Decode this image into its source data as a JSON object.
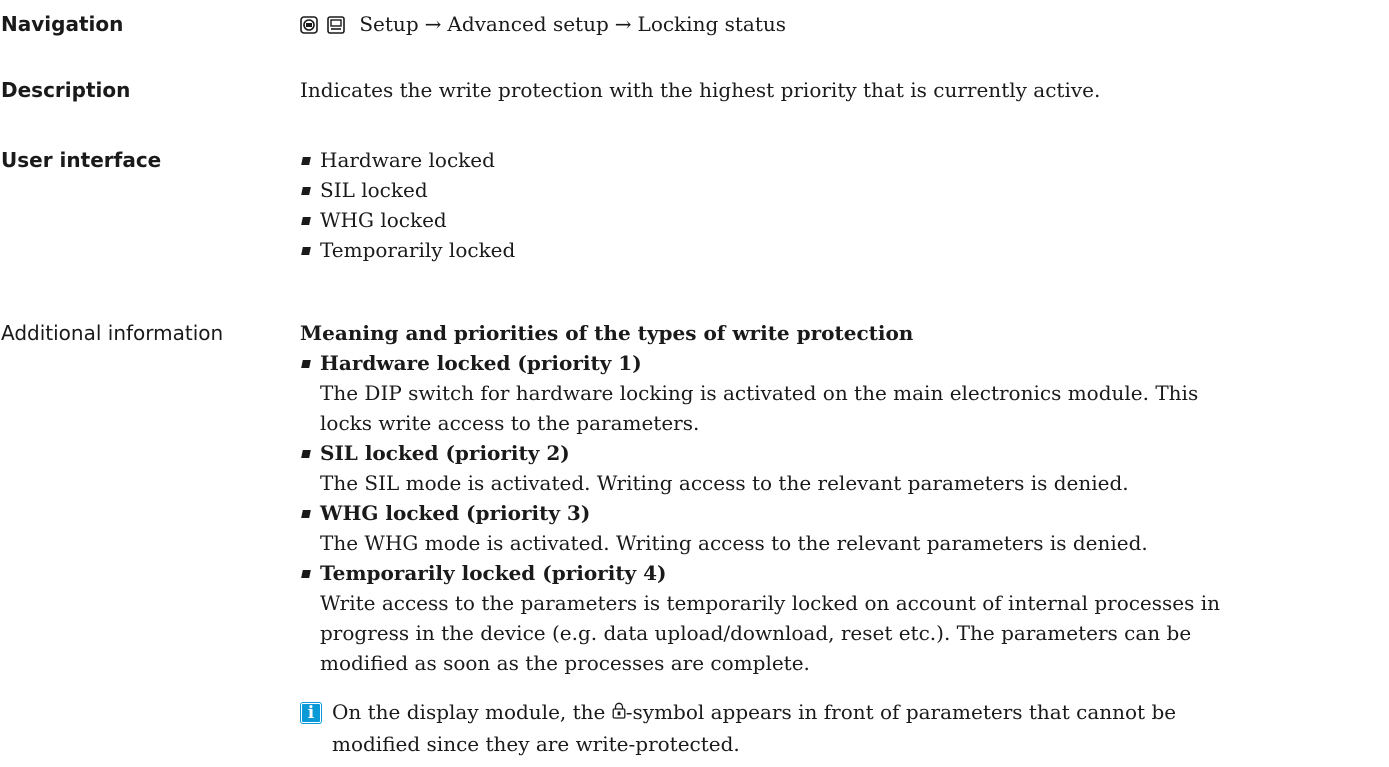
{
  "navigation": {
    "label": "Navigation",
    "path": [
      "Setup",
      "Advanced setup",
      "Locking status"
    ],
    "separator": "→",
    "icons": [
      "display-operating-icon",
      "display-module-icon"
    ]
  },
  "description": {
    "label": "Description",
    "text": "Indicates the write protection with the highest priority that is currently active."
  },
  "user_interface": {
    "label": "User interface",
    "options": [
      "Hardware locked",
      "SIL locked",
      "WHG locked",
      "Temporarily locked"
    ]
  },
  "additional_information": {
    "label": "Additional information",
    "heading": "Meaning and priorities of the types of write protection",
    "items": [
      {
        "title": "Hardware locked (priority 1)",
        "lines": [
          "The DIP switch for hardware locking is activated on the main electronics module. This",
          "locks write access to the parameters."
        ]
      },
      {
        "title": "SIL locked (priority 2)",
        "lines": [
          "The SIL mode is activated. Writing access to the relevant parameters is denied."
        ]
      },
      {
        "title": "WHG locked (priority 3)",
        "lines": [
          "The WHG mode is activated. Writing access to the relevant parameters is denied."
        ]
      },
      {
        "title": "Temporarily locked (priority 4)",
        "lines": [
          "Write access to the parameters is temporarily locked on account of internal processes in",
          "progress in the device (e.g. data upload/download, reset etc.). The parameters can be",
          "modified as soon as the processes are complete."
        ]
      }
    ],
    "note": {
      "icon": "info-icon",
      "icon_glyph": "i",
      "text_before": "On the display module, the ",
      "text_after": "-symbol appears in front of parameters that cannot be",
      "text_line2": "modified since they are write-protected.",
      "symbol_icon": "lock-icon"
    }
  },
  "colors": {
    "info_blue": "#0b9ad8",
    "text": "#1a1a1a"
  }
}
